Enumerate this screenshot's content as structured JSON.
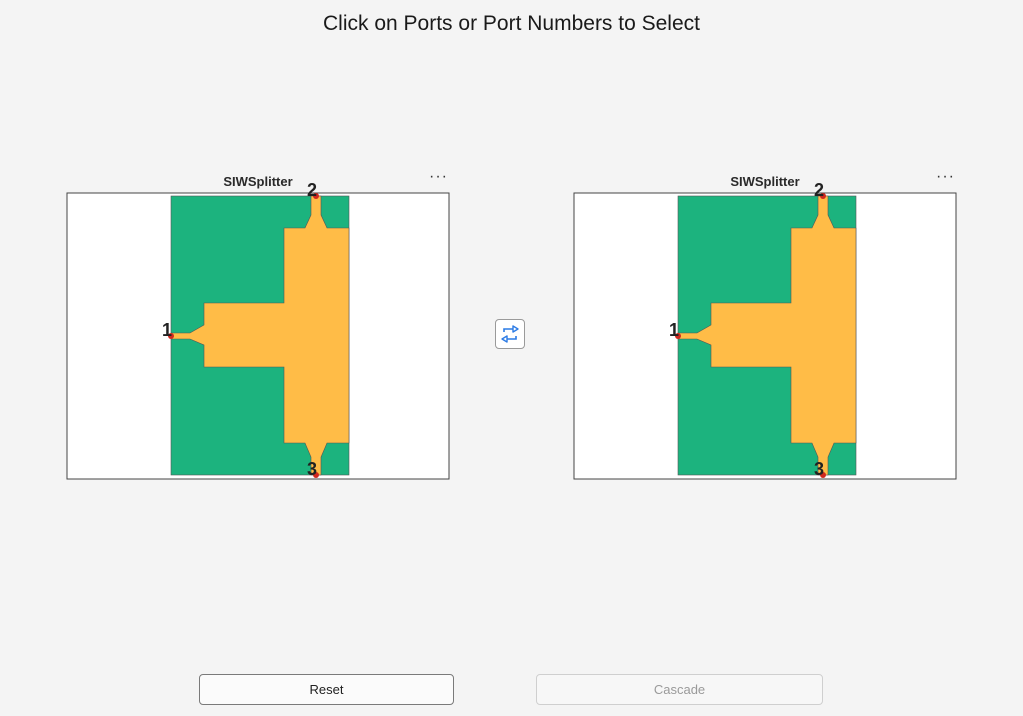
{
  "instruction": "Click on Ports or Port Numbers to Select",
  "panels": [
    {
      "title": "SIWSplitter",
      "more_label": "···",
      "ports": [
        "1",
        "2",
        "3"
      ]
    },
    {
      "title": "SIWSplitter",
      "more_label": "···",
      "ports": [
        "1",
        "2",
        "3"
      ]
    }
  ],
  "buttons": {
    "reset": "Reset",
    "cascade": "Cascade"
  },
  "colors": {
    "substrate": "#1cb37e",
    "conductor": "#ffbc47",
    "port_marker": "#d0281e",
    "swap_icon": "#2c7be5"
  },
  "icons": {
    "swap": "swap-arrows-icon",
    "more": "more-options-icon"
  }
}
